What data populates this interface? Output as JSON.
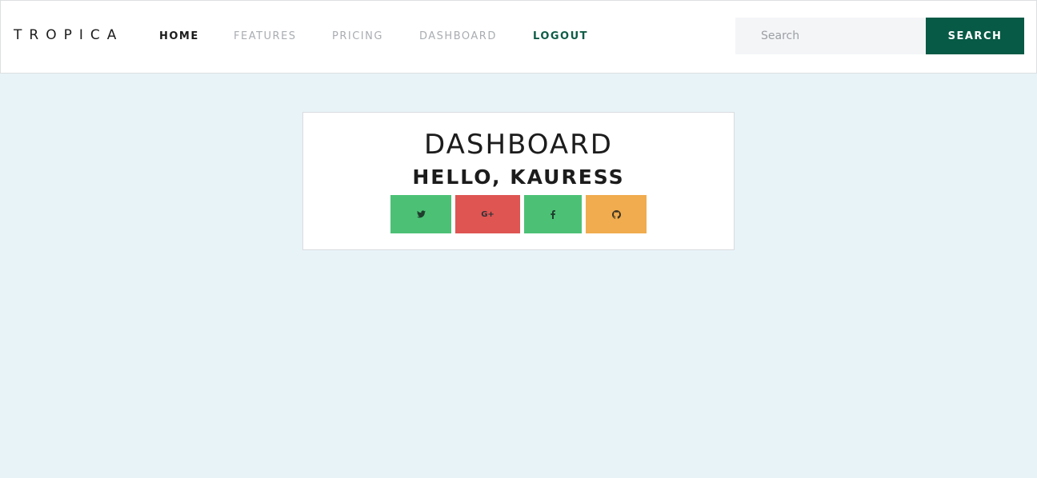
{
  "header": {
    "brand": "TROPICA",
    "nav": [
      {
        "label": "HOME"
      },
      {
        "label": "FEATURES"
      },
      {
        "label": "PRICING"
      },
      {
        "label": "DASHBOARD"
      },
      {
        "label": "LOGOUT"
      }
    ],
    "search": {
      "placeholder": "Search",
      "value": "",
      "button_label": "SEARCH"
    }
  },
  "dashboard": {
    "title": "DASHBOARD",
    "greeting": "HELLO, KAURESS",
    "social_buttons": [
      {
        "network": "twitter",
        "icon": "twitter-icon",
        "color": "#4cc176"
      },
      {
        "network": "google-plus",
        "icon": "google-plus-icon",
        "glyph": "G+",
        "color": "#de5552"
      },
      {
        "network": "facebook",
        "icon": "facebook-icon",
        "color": "#4cc176"
      },
      {
        "network": "github",
        "icon": "github-icon",
        "color": "#f0ac4e"
      }
    ]
  },
  "colors": {
    "page_background": "#e8f3f8",
    "accent": "#075a45",
    "logout": "#0d5c46",
    "nav_inactive": "#a9adb1"
  }
}
